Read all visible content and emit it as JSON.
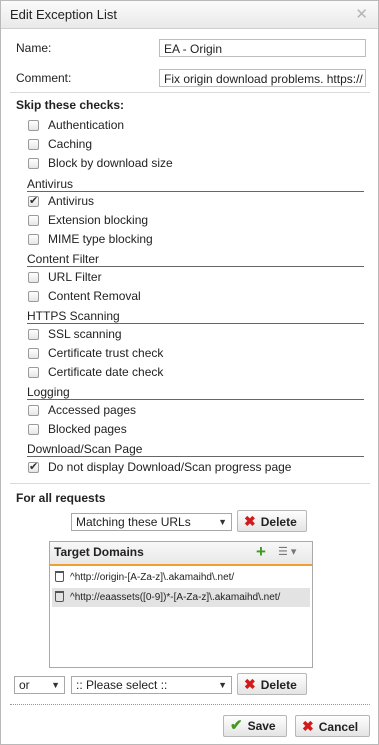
{
  "dialog": {
    "title": "Edit Exception List",
    "close_glyph": "✕"
  },
  "form": {
    "name_label": "Name:",
    "name_value": "EA - Origin",
    "comment_label": "Comment:",
    "comment_value": "Fix origin download problems. https://"
  },
  "skip": {
    "heading": "Skip these checks:",
    "general": [
      {
        "label": "Authentication",
        "checked": false
      },
      {
        "label": "Caching",
        "checked": false
      },
      {
        "label": "Block by download size",
        "checked": false
      }
    ],
    "sections": [
      {
        "title": "Antivirus",
        "items": [
          {
            "label": "Antivirus",
            "checked": true
          },
          {
            "label": "Extension blocking",
            "checked": false
          },
          {
            "label": "MIME type blocking",
            "checked": false
          }
        ]
      },
      {
        "title": "Content Filter",
        "items": [
          {
            "label": "URL Filter",
            "checked": false
          },
          {
            "label": "Content Removal",
            "checked": false
          }
        ]
      },
      {
        "title": "HTTPS Scanning",
        "items": [
          {
            "label": "SSL scanning",
            "checked": false
          },
          {
            "label": "Certificate trust check",
            "checked": false
          },
          {
            "label": "Certificate date check",
            "checked": false
          }
        ]
      },
      {
        "title": "Logging",
        "items": [
          {
            "label": "Accessed pages",
            "checked": false
          },
          {
            "label": "Blocked pages",
            "checked": false
          }
        ]
      },
      {
        "title": "Download/Scan Page",
        "items": [
          {
            "label": "Do not display Download/Scan progress page",
            "checked": true
          }
        ]
      }
    ]
  },
  "requests": {
    "heading": "For all requests",
    "match_select": "Matching these URLs",
    "delete_label": "Delete",
    "panel_title": "Target Domains",
    "domains": [
      "^http://origin-[A-Za-z]\\.akamaihd\\.net/",
      "^http://eaassets([0-9])*-[A-Za-z]\\.akamaihd\\.net/"
    ],
    "or_select": "or",
    "please_select": ":: Please select ::",
    "delete2_label": "Delete"
  },
  "footer": {
    "save_label": "Save",
    "cancel_label": "Cancel"
  },
  "colors": {
    "accent_orange": "#f0a030",
    "save_green": "#3f9a1f",
    "delete_red": "#d21a1a"
  }
}
